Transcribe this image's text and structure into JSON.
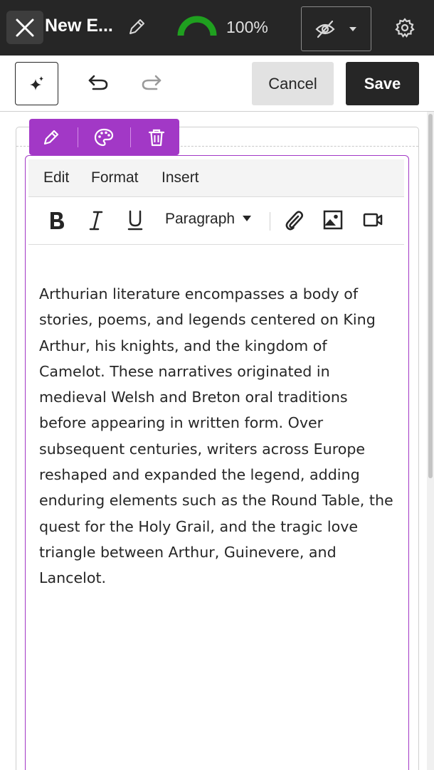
{
  "header": {
    "title": "New E...",
    "progress_text": "100%",
    "progress_fraction": 1.0,
    "gauge_color": "#1fa01f"
  },
  "toolbar": {
    "cancel_label": "Cancel",
    "save_label": "Save"
  },
  "block_toolbar": {
    "accent_color": "#a238c6",
    "icons": [
      "pencil-icon",
      "palette-icon",
      "trash-icon"
    ]
  },
  "editor": {
    "menu": [
      "Edit",
      "Format",
      "Insert"
    ],
    "format": {
      "paragraph_style": "Paragraph"
    },
    "content": "Arthurian literature encompasses a body of stories, poems, and legends centered on King Arthur, his knights, and the kingdom of Camelot. These narratives originated in medieval Welsh and Breton oral traditions before appearing in written form. Over subsequent centuries, writers across Europe reshaped and expanded the legend, adding enduring elements such as the Round Table, the quest for the Holy Grail, and the tragic love triangle between Arthur, Guinevere, and Lancelot."
  }
}
